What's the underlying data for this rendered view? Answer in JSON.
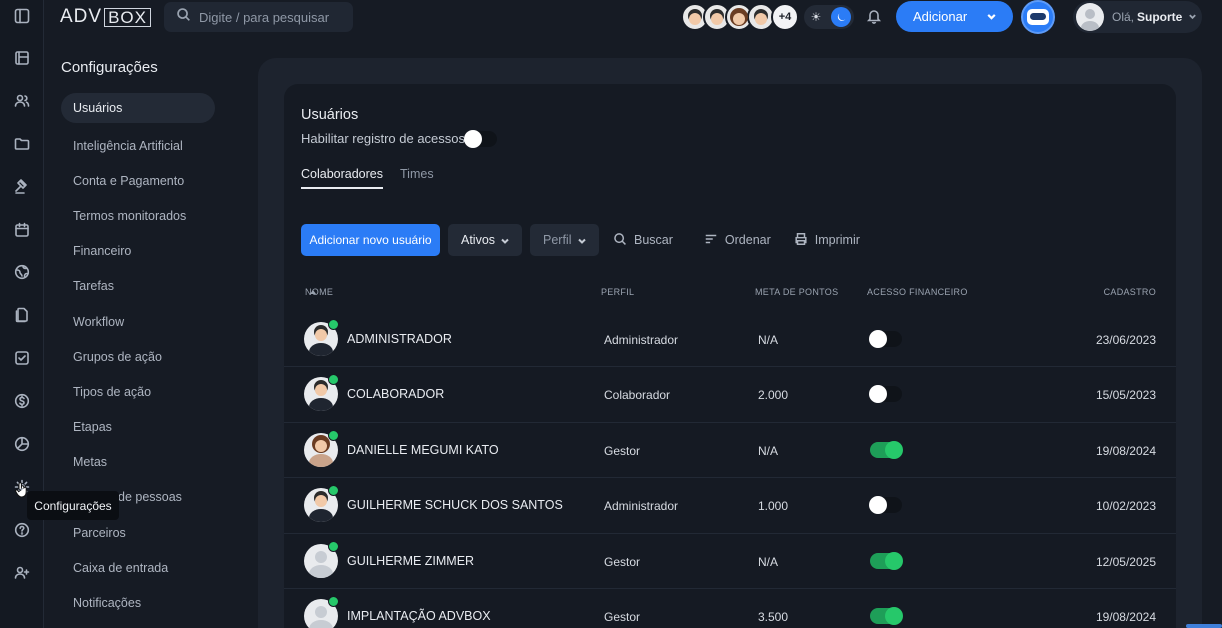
{
  "topbar": {
    "logo_left": "ADV",
    "logo_right": "BOX",
    "search_placeholder": "Digite / para pesquisar",
    "avatars_more": "+4",
    "add_label": "Adicionar",
    "greeting": "Olá,",
    "user_name": "Suporte"
  },
  "colors": {
    "accent": "#2b7cf6",
    "online": "#26c86a",
    "bg": "#161b24"
  },
  "sidebar_title": "Configurações",
  "menu": [
    "Usuários",
    "Inteligência Artificial",
    "Conta e Pagamento",
    "Termos monitorados",
    "Financeiro",
    "Tarefas",
    "Workflow",
    "Grupos de ação",
    "Tipos de ação",
    "Etapas",
    "Metas",
    "de pessoas",
    "Parceiros",
    "Caixa de entrada",
    "Notificações"
  ],
  "tooltip": "Configurações",
  "card": {
    "title": "Usuários",
    "register_label": "Habilitar registro de acessos",
    "tabs": [
      "Colaboradores",
      "Times"
    ]
  },
  "toolbar": {
    "add_user": "Adicionar novo usuário",
    "status_select": "Ativos",
    "profile_select": "Perfil",
    "search": "Buscar",
    "sort": "Ordenar",
    "print": "Imprimir"
  },
  "table": {
    "columns": [
      "NOME",
      "PERFIL",
      "META DE PONTOS",
      "ACESSO FINANCEIRO",
      "CADASTRO"
    ],
    "rows": [
      {
        "name": "ADMINISTRADOR",
        "profile": "Administrador",
        "goal": "N/A",
        "finance": false,
        "date": "23/06/2023",
        "avatar": "photo"
      },
      {
        "name": "COLABORADOR",
        "profile": "Colaborador",
        "goal": "2.000",
        "finance": false,
        "date": "15/05/2023",
        "avatar": "photo"
      },
      {
        "name": "DANIELLE MEGUMI KATO",
        "profile": "Gestor",
        "goal": "N/A",
        "finance": true,
        "date": "19/08/2024",
        "avatar": "photo-f"
      },
      {
        "name": "GUILHERME SCHUCK DOS SANTOS",
        "profile": "Administrador",
        "goal": "1.000",
        "finance": false,
        "date": "10/02/2023",
        "avatar": "photo"
      },
      {
        "name": "GUILHERME ZIMMER",
        "profile": "Gestor",
        "goal": "N/A",
        "finance": true,
        "date": "12/05/2025",
        "avatar": "default"
      },
      {
        "name": "IMPLANTAÇÃO ADVBOX",
        "profile": "Gestor",
        "goal": "3.500",
        "finance": true,
        "date": "19/08/2024",
        "avatar": "default"
      }
    ]
  }
}
